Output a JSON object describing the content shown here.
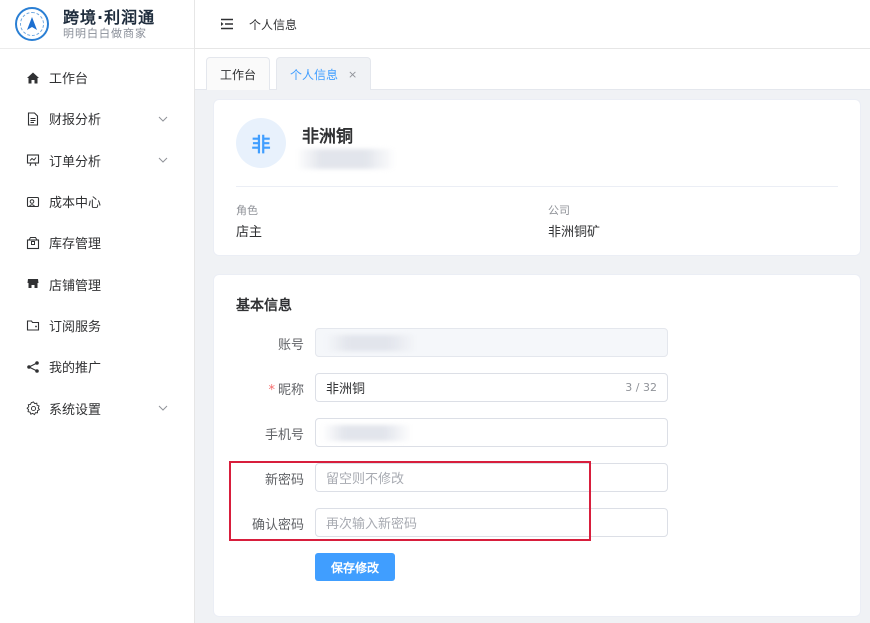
{
  "brand": {
    "title": "跨境·利润通",
    "subtitle": "明明白白做商家"
  },
  "sidebar": {
    "items": [
      {
        "label": "工作台",
        "icon": "home-icon",
        "has_submenu": false
      },
      {
        "label": "财报分析",
        "icon": "document-icon",
        "has_submenu": true
      },
      {
        "label": "订单分析",
        "icon": "presentation-chart-icon",
        "has_submenu": true
      },
      {
        "label": "成本中心",
        "icon": "wallet-icon",
        "has_submenu": false
      },
      {
        "label": "库存管理",
        "icon": "box-icon",
        "has_submenu": false
      },
      {
        "label": "店铺管理",
        "icon": "shop-icon",
        "has_submenu": false
      },
      {
        "label": "订阅服务",
        "icon": "folder-icon",
        "has_submenu": false
      },
      {
        "label": "我的推广",
        "icon": "share-icon",
        "has_submenu": false
      },
      {
        "label": "系统设置",
        "icon": "gear-icon",
        "has_submenu": true
      }
    ]
  },
  "header": {
    "breadcrumb": "个人信息"
  },
  "tabs": [
    {
      "label": "工作台",
      "active": false
    },
    {
      "label": "个人信息",
      "active": true,
      "close": "×"
    }
  ],
  "profile": {
    "avatar_char": "非",
    "name": "非洲铜",
    "role_label": "角色",
    "role_value": "店主",
    "company_label": "公司",
    "company_value": "非洲铜矿"
  },
  "basic_info": {
    "title": "基本信息",
    "account_label": "账号",
    "nickname_label": "昵称",
    "nickname_required": "*",
    "nickname_value": "非洲铜",
    "nickname_count": "3 / 32",
    "phone_label": "手机号",
    "new_password_label": "新密码",
    "new_password_placeholder": "留空则不修改",
    "confirm_password_label": "确认密码",
    "confirm_password_placeholder": "再次输入新密码",
    "save_label": "保存修改"
  },
  "colors": {
    "accent": "#409eff",
    "highlight": "#d81e3c",
    "required": "#f56c6c"
  }
}
